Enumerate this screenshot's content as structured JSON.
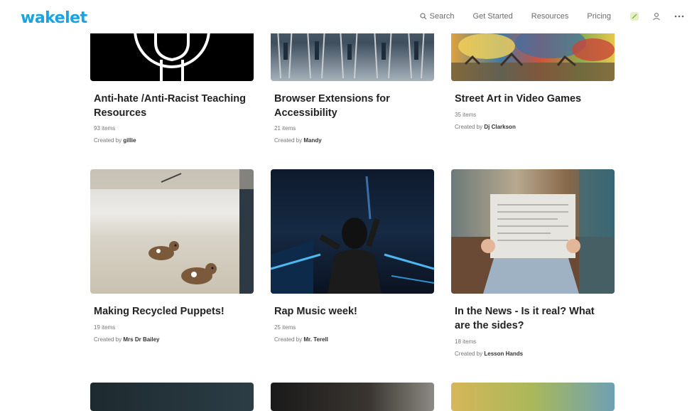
{
  "header": {
    "logo": "wakelet",
    "nav": [
      "Search",
      "Get Started",
      "Resources",
      "Pricing"
    ],
    "icons": [
      "search-icon",
      "grid-icon",
      "user-icon",
      "more-icon"
    ]
  },
  "cards": [
    {
      "title": "Anti-hate /Anti-Racist Teaching Resources",
      "items": "93 items",
      "created_by": "Created by",
      "author": "gillie"
    },
    {
      "title": "Browser Extensions for Accessibility",
      "items": "21 items",
      "created_by": "Created by",
      "author": "Mandy"
    },
    {
      "title": "Street Art in Video Games",
      "items": "35 items",
      "created_by": "Created by",
      "author": "Dj Clarkson"
    },
    {
      "title": "Making Recycled Puppets!",
      "items": "19 items",
      "created_by": "Created by",
      "author": "Mrs Dr Bailey"
    },
    {
      "title": "Rap Music week!",
      "items": "25 items",
      "created_by": "Created by",
      "author": "Mr. Terell"
    },
    {
      "title": "In the News - Is it real? What are the sides?",
      "items": "18 items",
      "created_by": "Created by",
      "author": "Lesson Hands"
    }
  ]
}
